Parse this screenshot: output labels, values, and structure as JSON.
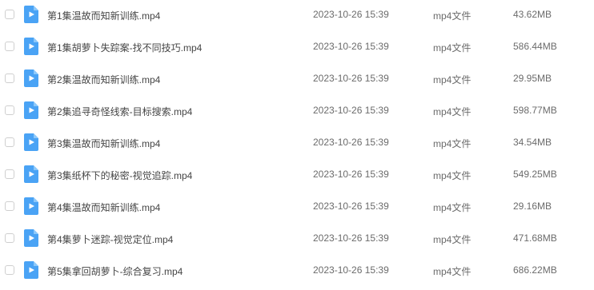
{
  "file_icon": {
    "name": "video-file-icon",
    "color": "#4AA3F5"
  },
  "files": [
    {
      "name": "第1集温故而知新训练.mp4",
      "modified": "2023-10-26 15:39",
      "type": "mp4文件",
      "size": "43.62MB"
    },
    {
      "name": "第1集胡萝卜失踪案-找不同技巧.mp4",
      "modified": "2023-10-26 15:39",
      "type": "mp4文件",
      "size": "586.44MB"
    },
    {
      "name": "第2集温故而知新训练.mp4",
      "modified": "2023-10-26 15:39",
      "type": "mp4文件",
      "size": "29.95MB"
    },
    {
      "name": "第2集追寻奇怪线索-目标搜索.mp4",
      "modified": "2023-10-26 15:39",
      "type": "mp4文件",
      "size": "598.77MB"
    },
    {
      "name": "第3集温故而知新训练.mp4",
      "modified": "2023-10-26 15:39",
      "type": "mp4文件",
      "size": "34.54MB"
    },
    {
      "name": "第3集纸杯下的秘密-视觉追踪.mp4",
      "modified": "2023-10-26 15:39",
      "type": "mp4文件",
      "size": "549.25MB"
    },
    {
      "name": "第4集温故而知新训练.mp4",
      "modified": "2023-10-26 15:39",
      "type": "mp4文件",
      "size": "29.16MB"
    },
    {
      "name": "第4集萝卜迷踪-视觉定位.mp4",
      "modified": "2023-10-26 15:39",
      "type": "mp4文件",
      "size": "471.68MB"
    },
    {
      "name": "第5集拿回胡萝卜-综合复习.mp4",
      "modified": "2023-10-26 15:39",
      "type": "mp4文件",
      "size": "686.22MB"
    }
  ]
}
